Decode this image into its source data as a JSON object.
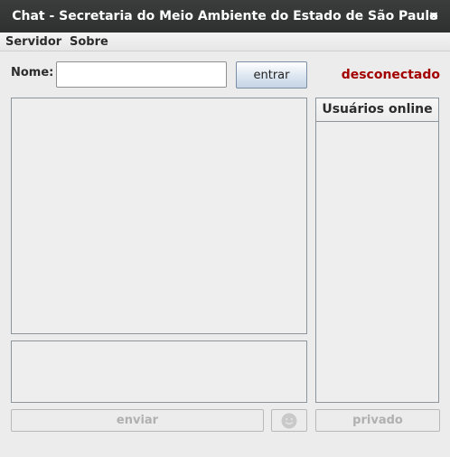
{
  "window": {
    "title": "Chat - Secretaria do Meio Ambiente do Estado de São Paulo",
    "close_glyph": "×"
  },
  "menubar": {
    "items": [
      {
        "label": "Servidor"
      },
      {
        "label": "Sobre"
      }
    ]
  },
  "login": {
    "name_label": "Nome:",
    "name_value": "",
    "enter_button": "entrar"
  },
  "status": {
    "text": "desconectado",
    "color": "#a30000"
  },
  "users_panel": {
    "header": "Usuários online",
    "users": []
  },
  "messages": [],
  "compose": {
    "value": ""
  },
  "actions": {
    "send_button": "enviar",
    "emoji_button_icon": "smiley-icon",
    "private_button": "privado",
    "enabled": false
  }
}
